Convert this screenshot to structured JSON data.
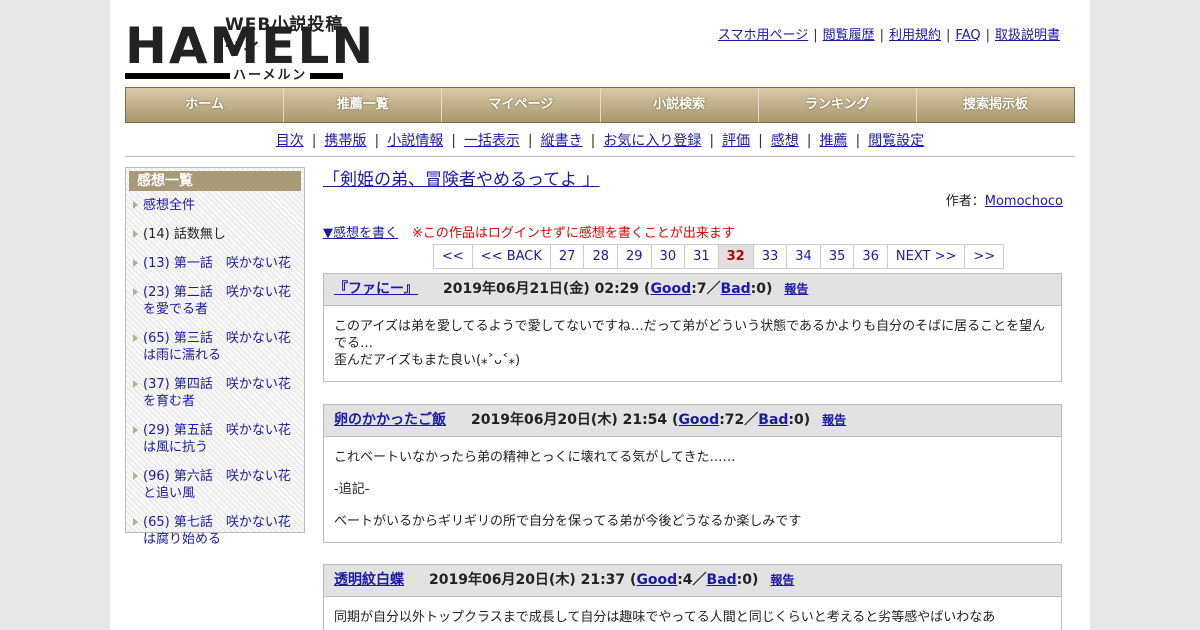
{
  "header": {
    "logo_sub": "WEB小説投稿サイト",
    "logo_main": "HAMELN",
    "logo_kana": "ハーメルン",
    "links": [
      "スマホ用ページ",
      "閲覧履歴",
      "利用規約",
      "FAQ",
      "取扱説明書"
    ]
  },
  "nav": [
    "ホーム",
    "推薦一覧",
    "マイページ",
    "小説検索",
    "ランキング",
    "捜索掲示板"
  ],
  "subnav": [
    "目次",
    "携帯版",
    "小説情報",
    "一括表示",
    "縦書き",
    "お気に入り登録",
    "評価",
    "感想",
    "推薦",
    "閲覧設定"
  ],
  "sidebar": {
    "title": "感想一覧",
    "items": [
      {
        "label": "感想全件",
        "link": true
      },
      {
        "label": "(14) 話数無し",
        "link": false
      },
      {
        "label": "(13) 第一話　咲かない花",
        "link": true
      },
      {
        "label": "(23) 第二話　咲かない花を愛でる者",
        "link": true
      },
      {
        "label": "(65) 第三話　咲かない花は雨に濡れる",
        "link": true
      },
      {
        "label": "(37) 第四話　咲かない花を育む者",
        "link": true
      },
      {
        "label": "(29) 第五話　咲かない花は風に抗う",
        "link": true
      },
      {
        "label": "(96) 第六話　咲かない花と追い風",
        "link": true
      },
      {
        "label": "(65) 第七話　咲かない花は腐り始める",
        "link": true
      }
    ]
  },
  "main": {
    "novel_title": "「剣姫の弟、冒険者やめるってよ 」",
    "author_label": "作者：",
    "author_name": "Momochoco",
    "write_link": "▼感想を書く",
    "warning": "※この作品はログインせずに感想を書くことが出来ます",
    "pager": [
      "<<",
      "<< BACK",
      "27",
      "28",
      "29",
      "30",
      "31",
      "32",
      "33",
      "34",
      "35",
      "36",
      "NEXT >>",
      ">>"
    ],
    "pager_current": "32"
  },
  "reviews": [
    {
      "name": "『ファにー』",
      "date": "2019年06月21日(金) 02:29 (",
      "good": "Good",
      "good_count": ":7／",
      "bad": "Bad",
      "bad_count": ":0)",
      "report": "報告",
      "lines": [
        "このアイズは弟を愛してるようで愛してないですね…だって弟がどういう状態であるかよりも自分のそばに居ることを望んでる…",
        "歪んだアイズもまた良い(⁎˃ᴗ˂⁎)"
      ]
    },
    {
      "name": "卵のかかったご飯",
      "date": "2019年06月20日(木) 21:54 (",
      "good": "Good",
      "good_count": ":72／",
      "bad": "Bad",
      "bad_count": ":0)",
      "report": "報告",
      "lines": [
        "これベートいなかったら弟の精神とっくに壊れてる気がしてきた……",
        "-追記-",
        "ベートがいるからギリギリの所で自分を保ってる弟が今後どうなるか楽しみです"
      ]
    },
    {
      "name": "透明紋白蝶",
      "date": "2019年06月20日(木) 21:37 (",
      "good": "Good",
      "good_count": ":4／",
      "bad": "Bad",
      "bad_count": ":0)",
      "report": "報告",
      "lines": [
        "同期が自分以外トップクラスまで成長して自分は趣味でやってる人間と同じくらいと考えると劣等感やばいわなあ"
      ]
    }
  ]
}
